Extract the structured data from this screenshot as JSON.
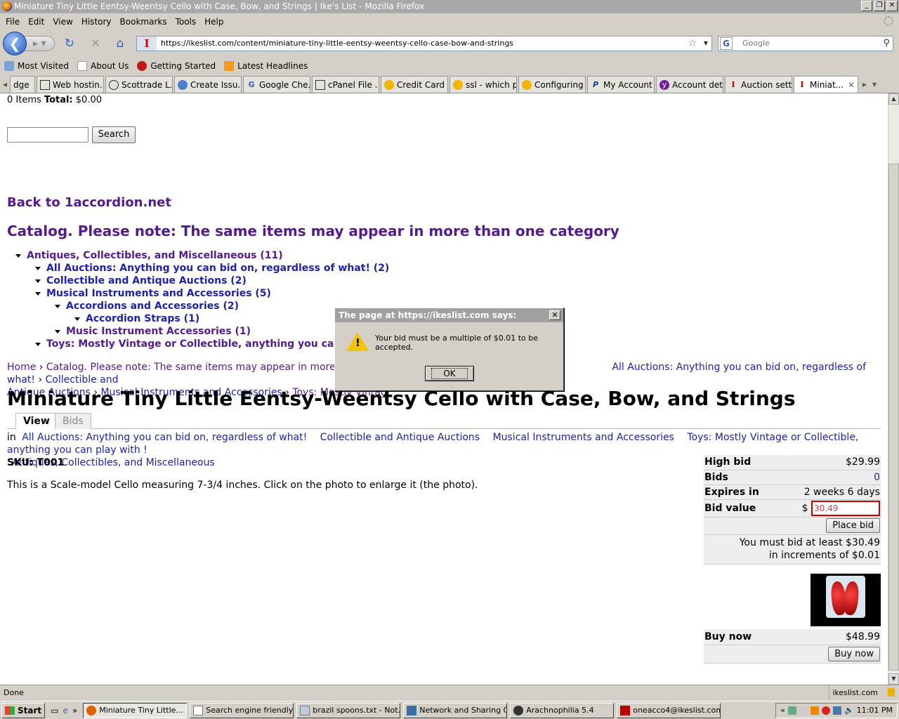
{
  "window": {
    "title": "Miniature Tiny Little Eentsy-Weentsy Cello with Case, Bow, and Strings | Ike's List - Mozilla Firefox"
  },
  "menu": [
    "File",
    "Edit",
    "View",
    "History",
    "Bookmarks",
    "Tools",
    "Help"
  ],
  "nav": {
    "url": "https://ikeslist.com/content/miniature-tiny-little-eentsy-weentsy-cello-case-bow-and-strings",
    "search_placeholder": "Google"
  },
  "bookmarks": [
    "Most Visited",
    "About Us",
    "Getting Started",
    "Latest Headlines"
  ],
  "tabs": [
    "dge",
    "Web hostin...",
    "Scottrade L...",
    "Create Issu...",
    "Google Che...",
    "cPanel File ...",
    "Credit Card ...",
    "ssl - which p...",
    "Configuring ...",
    "My Account ...",
    "Account det...",
    "Auction sett...",
    "Miniat..."
  ],
  "page": {
    "cart_count": "0 Items",
    "cart_total_label": "Total:",
    "cart_total": "$0.00",
    "search_button": "Search",
    "back_link": "Back to 1accordion.net",
    "catalog_link": "Catalog. Please note: The same items may appear in more than one category",
    "tree": [
      "Antiques, Collectibles, and Miscellaneous (11)",
      "All Auctions: Anything you can bid on, regardless of what! (2)",
      "Collectible and Antique Auctions (2)",
      "Musical Instruments and Accessories (5)",
      "Accordions and Accessories (2)",
      "Accordion Straps (1)",
      "Music Instrument Accessories (1)",
      "Toys: Mostly Vintage or Collectible, anything you can play w"
    ],
    "breadcrumb": {
      "home": "Home",
      "catalog": "Catalog. Please note: The same items may appear in more than one",
      "all_auctions": "All Auctions: Anything you can bid on, regardless of what!",
      "collectible": "Collectible and",
      "antique_auctions": "Antique Auctions",
      "musical": "Musical Instruments and Accessories",
      "toys": "Toys: Mostly Vintag",
      "sep": "›"
    },
    "title": "Miniature Tiny Little Eentsy-Weentsy Cello with Case, Bow, and Strings",
    "view_tab": "View",
    "bids_tab": "Bids",
    "in_label": "in",
    "terms": [
      "All Auctions: Anything you can bid on, regardless of what!",
      "Collectible and Antique Auctions",
      "Musical Instruments and Accessories",
      "Toys: Mostly Vintage or Collectible, anything you can play with !",
      "Antiques, Collectibles, and Miscellaneous"
    ],
    "sku": "SKU: T001",
    "description": "This is a Scale-model Cello measuring 7-3/4 inches. Click on the photo to enlarge it (the photo).",
    "bid": {
      "high_bid_label": "High bid",
      "high_bid": "$29.99",
      "bids_label": "Bids",
      "bids": "0",
      "expires_label": "Expires in",
      "expires": "2 weeks 6 days",
      "bid_value_label": "Bid value",
      "currency": "$",
      "bid_value": "30.49",
      "place_bid": "Place bid",
      "min_note": "You must bid at least $30.49",
      "inc_note": "in increments of $0.01"
    },
    "buy": {
      "label": "Buy now",
      "price": "$48.99",
      "button": "Buy now"
    }
  },
  "dialog": {
    "title": "The page at https://ikeslist.com says:",
    "message": "Your bid must be a multiple of $0.01 to be accepted.",
    "ok": "OK"
  },
  "status": {
    "text": "Done",
    "host": "ikeslist.com"
  },
  "taskbar": {
    "start": "Start",
    "tasks": [
      "Miniature Tiny Little...",
      "Search engine friendly ...",
      "brazil spoons.txt - Not...",
      "Network and Sharing C...",
      "Arachnophilia 5.4",
      "oneacco4@ikeslist.com..."
    ],
    "clock": "11:01 PM"
  }
}
